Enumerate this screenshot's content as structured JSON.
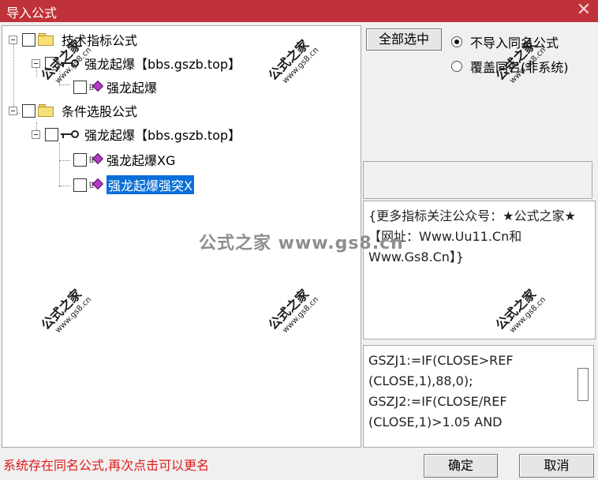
{
  "window": {
    "title": "导入公式",
    "close_glyph": "✕"
  },
  "tree": {
    "nodes": [
      {
        "label": "技术指标公式",
        "icon": "folder-icon"
      },
      {
        "label": "强龙起爆【bbs.gszb.top】",
        "icon": "key-icon"
      },
      {
        "label": "强龙起爆",
        "icon": "formula-gem-icon"
      },
      {
        "label": "条件选股公式",
        "icon": "folder-icon"
      },
      {
        "label": "强龙起爆【bbs.gszb.top】",
        "icon": "key-icon"
      },
      {
        "label": "强龙起爆XG",
        "icon": "formula-gem-icon"
      },
      {
        "label": "强龙起爆强突X",
        "icon": "formula-gem-icon",
        "selected": true
      }
    ]
  },
  "options": {
    "select_all_label": "全部选中",
    "radio_no_import": "不导入同名公式",
    "radio_overwrite": "覆盖同名(非系统)",
    "selected_radio": "radio_no_import"
  },
  "info": {
    "description": "{更多指标关注公众号：★公式之家★ 【网址：Www.Uu11.Cn和Www.Gs8.Cn】}"
  },
  "code": {
    "lines": [
      "GSZJ1:=IF(CLOSE>REF",
      "(CLOSE,1),88,0);",
      "GSZJ2:=IF(CLOSE/REF",
      "(CLOSE,1)>1.05 AND"
    ]
  },
  "footer": {
    "status": "系统存在同名公式,再次点击可以更名",
    "ok_label": "确定",
    "cancel_label": "取消"
  },
  "watermarks": {
    "brand": "公式之家",
    "site": "www.gs8.cn",
    "center": "公式之家 www.gs8.cn"
  },
  "colors": {
    "titlebar": "#c0323a",
    "selection": "#0a6fd8",
    "status_text": "#e01a1a",
    "gem": "#b03cc0"
  }
}
